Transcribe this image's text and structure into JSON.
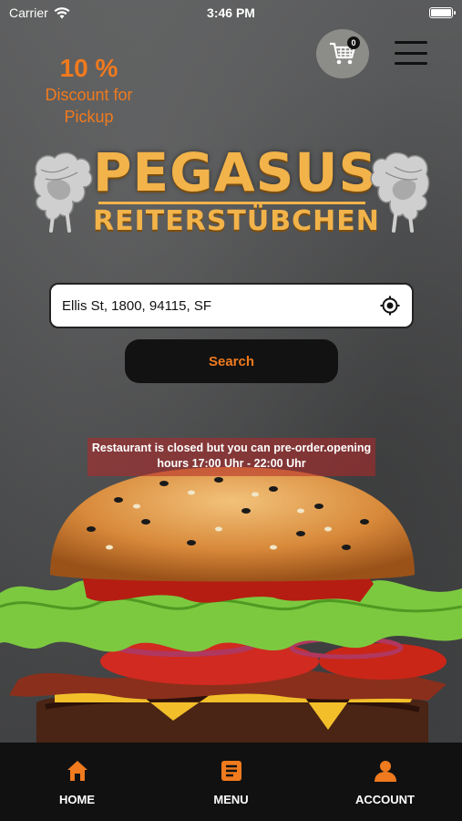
{
  "status_bar": {
    "carrier": "Carrier",
    "time": "3:46 PM"
  },
  "header": {
    "cart_count": "0",
    "icons": [
      "cart-icon",
      "hamburger-menu-icon"
    ]
  },
  "discount": {
    "percent": "10 %",
    "text": "Discount for Pickup"
  },
  "logo": {
    "title": "PEGASUS",
    "subtitle": "REITERSTÜBCHEN"
  },
  "address": {
    "value": "Ellis St, 1800, 94115, SF",
    "icon": "location-target-icon"
  },
  "search": {
    "label": "Search"
  },
  "notice": {
    "text": "Restaurant is closed but you can pre-order.opening hours 17:00 Uhr - 22:00 Uhr"
  },
  "bottom_nav": {
    "items": [
      {
        "label": "HOME",
        "icon": "home-icon"
      },
      {
        "label": "MENU",
        "icon": "menu-book-icon"
      },
      {
        "label": "ACCOUNT",
        "icon": "person-icon"
      }
    ]
  },
  "colors": {
    "accent": "#f07a1e",
    "logo_gold": "#f2b34a",
    "nav_bg": "#111111",
    "notice_bg": "#b42828"
  }
}
